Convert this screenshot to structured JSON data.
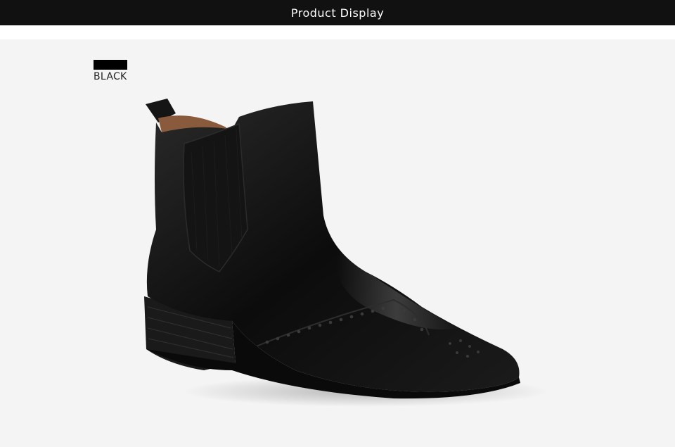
{
  "header": {
    "title": "Product Display"
  },
  "product": {
    "color_label": "BLACK",
    "swatch_color": "#000000",
    "image_subject": "ankle-boot-icon"
  },
  "colors": {
    "header_bg": "#111111",
    "photo_bg": "#f4f4f4"
  }
}
